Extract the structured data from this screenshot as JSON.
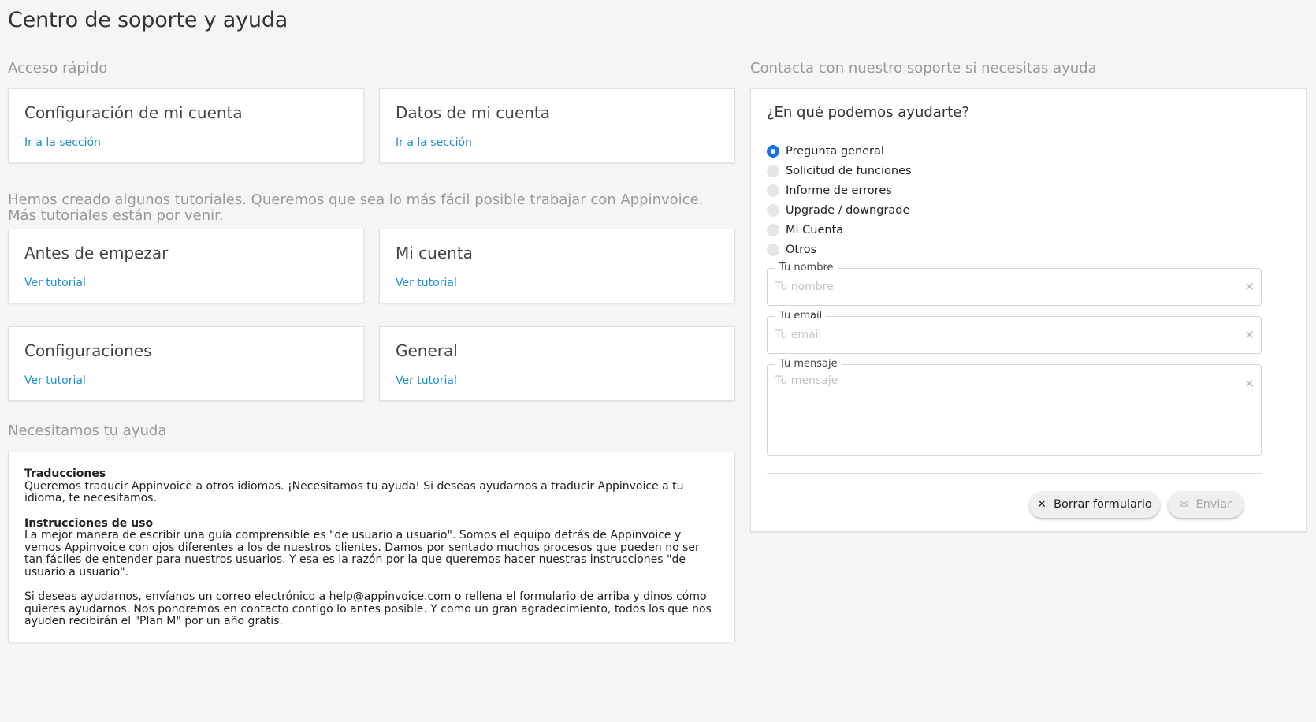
{
  "page": {
    "title": "Centro de soporte y ayuda"
  },
  "quick_access": {
    "label": "Acceso rápido",
    "cards": [
      {
        "title": "Configuración de mi cuenta",
        "link": "Ir a la sección"
      },
      {
        "title": "Datos de mi cuenta",
        "link": "Ir a la sección"
      }
    ]
  },
  "tutorials": {
    "intro": "Hemos creado algunos tutoriales. Queremos que sea lo más fácil posible trabajar con Appinvoice. Más tutoriales están por venir.",
    "cards": [
      {
        "title": "Antes de empezar",
        "link": "Ver tutorial"
      },
      {
        "title": "Mi cuenta",
        "link": "Ver tutorial"
      },
      {
        "title": "Configuraciones",
        "link": "Ver tutorial"
      },
      {
        "title": "General",
        "link": "Ver tutorial"
      }
    ]
  },
  "help": {
    "label": "Necesitamos tu ayuda",
    "blocks": [
      {
        "title": "Traducciones",
        "text": "Queremos traducir Appinvoice a otros idiomas. ¡Necesitamos tu ayuda! Si deseas ayudarnos a traducir Appinvoice a tu idioma, te necesitamos."
      },
      {
        "title": "Instrucciones de uso",
        "text": "La mejor manera de escribir una guía comprensible es \"de usuario a usuario\". Somos el equipo detrás de Appinvoice y vemos Appinvoice con ojos diferentes a los de nuestros clientes. Damos por sentado muchos procesos que pueden no ser tan fáciles de entender para nuestros usuarios. Y esa es la razón por la que queremos hacer nuestras instrucciones \"de usuario a usuario\"."
      }
    ],
    "footer": "Si deseas ayudarnos, envíanos un correo electrónico a help@appinvoice.com o rellena el formulario de arriba y dinos cómo quieres ayudarnos. Nos pondremos en contacto contigo lo antes posible. Y como un gran agradecimiento, todos los que nos ayuden recibirán el \"Plan M\" por un año gratis."
  },
  "contact": {
    "label": "Contacta con nuestro soporte si necesitas ayuda",
    "heading": "¿En qué podemos ayudarte?",
    "options": [
      {
        "label": "Pregunta general",
        "checked": true
      },
      {
        "label": "Solicitud de funciones",
        "checked": false
      },
      {
        "label": "Informe de errores",
        "checked": false
      },
      {
        "label": "Upgrade / downgrade",
        "checked": false
      },
      {
        "label": "Mi Cuenta",
        "checked": false
      },
      {
        "label": "Otros",
        "checked": false
      }
    ],
    "fields": {
      "name": {
        "legend": "Tu nombre",
        "placeholder": "Tu nombre",
        "value": ""
      },
      "email": {
        "legend": "Tu email",
        "placeholder": "Tu email",
        "value": ""
      },
      "message": {
        "legend": "Tu mensaje",
        "placeholder": "Tu mensaje",
        "value": ""
      }
    },
    "buttons": {
      "clear": "Borrar formulario",
      "send": "Enviar"
    }
  },
  "icons": {
    "clear": "close-icon",
    "send": "envelope-icon"
  },
  "colors": {
    "link": "#1a8fd6",
    "radio_checked": "#1a73e8"
  }
}
